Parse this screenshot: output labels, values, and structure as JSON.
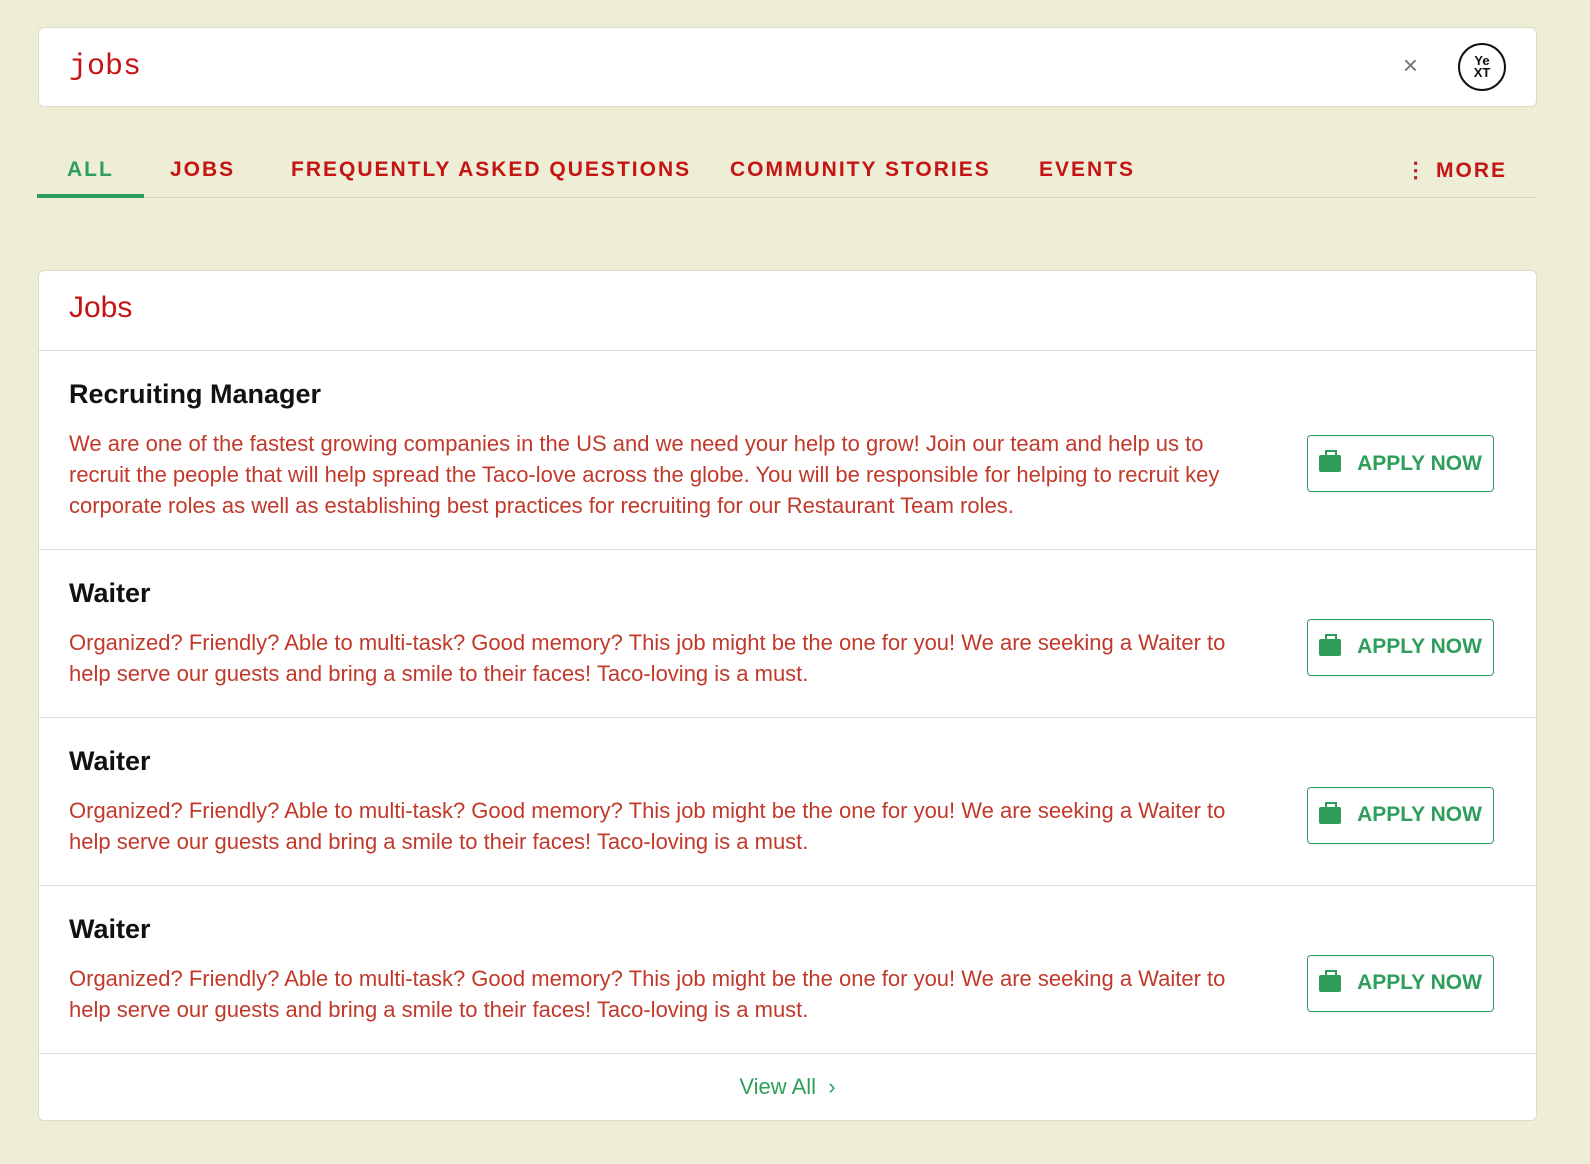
{
  "search": {
    "query": "jobs",
    "clear_icon": "×",
    "logo_line1": "Ye",
    "logo_line2": "XT"
  },
  "tabs": [
    {
      "label": "ALL"
    },
    {
      "label": "JOBS"
    },
    {
      "label": "FREQUENTLY ASKED QUESTIONS"
    },
    {
      "label": "COMMUNITY STORIES"
    },
    {
      "label": "EVENTS"
    },
    {
      "label": "MORE"
    }
  ],
  "more_icon": "⋮",
  "section": {
    "title": "Jobs",
    "view_all": "View All",
    "view_all_icon": "›",
    "items": [
      {
        "title": "Recruiting Manager",
        "description": "We are one of the fastest growing companies in the US and we need your help to grow! Join our team and help us to recruit the people that will help spread the Taco-love across the globe. You will be responsible for helping to recruit key corporate roles as well as establishing best practices for recruiting for our Restaurant Team roles.",
        "cta": "APPLY NOW"
      },
      {
        "title": "Waiter",
        "description": "Organized? Friendly? Able to multi-task? Good memory? This job might be the one for you! We are seeking a Waiter to help serve our guests and bring a smile to their faces! Taco-loving is a must.",
        "cta": "APPLY NOW"
      },
      {
        "title": "Waiter",
        "description": "Organized? Friendly? Able to multi-task? Good memory? This job might be the one for you! We are seeking a Waiter to help serve our guests and bring a smile to their faces! Taco-loving is a must.",
        "cta": "APPLY NOW"
      },
      {
        "title": "Waiter",
        "description": "Organized? Friendly? Able to multi-task? Good memory? This job might be the one for you! We are seeking a Waiter to help serve our guests and bring a smile to their faces! Taco-loving is a must.",
        "cta": "APPLY NOW"
      }
    ]
  },
  "colors": {
    "background": "#eeedd5",
    "accent_red": "#c41414",
    "accent_green": "#2e9e5a"
  }
}
